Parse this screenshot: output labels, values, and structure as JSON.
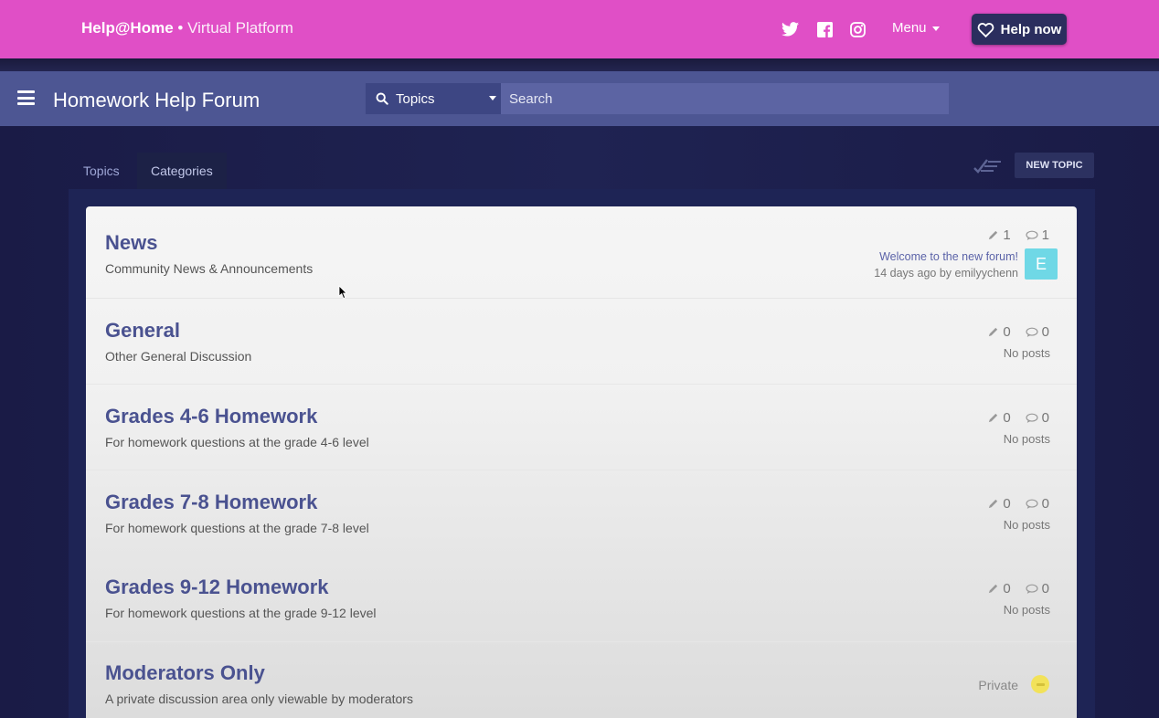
{
  "brand": {
    "name": "Help@Home",
    "separator": " • ",
    "subtitle": "Virtual Platform"
  },
  "top_nav": {
    "social_icons": [
      "twitter-icon",
      "facebook-icon",
      "instagram-icon"
    ],
    "menu_label": "Menu",
    "help_label": "Help now",
    "accent": "#e04fc6"
  },
  "forum": {
    "title": "Homework Help Forum",
    "scope_label": "Topics",
    "search_placeholder": "Search"
  },
  "tabs": {
    "topics": "Topics",
    "categories": "Categories"
  },
  "new_topic_label": "NEW TOPIC",
  "categories": [
    {
      "title": "News",
      "description": "Community News & Announcements",
      "topics": "1",
      "posts": "1",
      "latest_title": "Welcome to the new forum!",
      "latest_meta": "14 days ago by emilyychenn",
      "avatar_letter": "E"
    },
    {
      "title": "General",
      "description": "Other General Discussion",
      "topics": "0",
      "posts": "0",
      "status": "No posts"
    },
    {
      "title": "Grades 4-6 Homework",
      "description": "For homework questions at the grade 4-6 level",
      "topics": "0",
      "posts": "0",
      "status": "No posts"
    },
    {
      "title": "Grades 7-8 Homework",
      "description": "For homework questions at the grade 7-8 level",
      "topics": "0",
      "posts": "0",
      "status": "No posts"
    },
    {
      "title": "Grades 9-12 Homework",
      "description": "For homework questions at the grade 9-12 level",
      "topics": "0",
      "posts": "0",
      "status": "No posts"
    },
    {
      "title": "Moderators Only",
      "description": "A private discussion area only viewable by moderators",
      "status": "Private"
    }
  ]
}
